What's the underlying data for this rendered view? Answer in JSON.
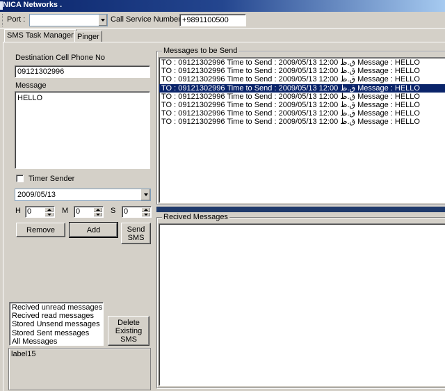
{
  "window": {
    "title": "NICA Networks ."
  },
  "toolbar": {
    "port_label": "Port :",
    "port_value": "",
    "call_service_label": "Call Service Number :",
    "call_service_value": "+9891100500"
  },
  "tabs": [
    {
      "label": "SMS Task Manager",
      "selected": true
    },
    {
      "label": "Pinger",
      "selected": false
    }
  ],
  "form": {
    "destination_label": "Destination Cell Phone No",
    "destination_value": "09121302996",
    "message_label": "Message",
    "message_value": "HELLO",
    "timer_label": "Timer Sender",
    "timer_checked": false,
    "date_value": "2009/05/13",
    "h_label": "H",
    "h_value": "0",
    "m_label": "M",
    "m_value": "0",
    "s_label": "S",
    "s_value": "0",
    "remove_button": "Remove",
    "add_button": "Add",
    "send_button": "Send SMS"
  },
  "messages_to_send": {
    "title": "Messages to be Send",
    "selected_index": 3,
    "items": [
      "TO : 09121302996 Time to Send : 2009/05/13 12:00 ق.ظ Message : HELLO",
      "TO : 09121302996 Time to Send : 2009/05/13 12:00 ق.ظ Message : HELLO",
      "TO : 09121302996 Time to Send : 2009/05/13 12:00 ق.ظ Message : HELLO",
      "TO : 09121302996 Time to Send : 2009/05/13 12:00 ق.ظ Message : HELLO",
      "TO : 09121302996 Time to Send : 2009/05/13 12:00 ق.ظ Message : HELLO",
      "TO : 09121302996 Time to Send : 2009/05/13 12:00 ق.ظ Message : HELLO",
      "TO : 09121302996 Time to Send : 2009/05/13 12:00 ق.ظ Message : HELLO",
      "TO : 09121302996 Time to Send : 2009/05/13 12:00 ق.ظ Message : HELLO"
    ]
  },
  "received": {
    "title": "Recived Messages"
  },
  "filter_list": {
    "items": [
      "Recived unread messages",
      "Recived read messages",
      "Stored Unsend messages",
      "Stored Sent messages",
      "All Messages"
    ]
  },
  "delete_button": "Delete Existing SMS",
  "status_label": "label15",
  "colors": {
    "selection": "#0a246a",
    "face": "#d4d0c8",
    "splitter": "#1f3a6b"
  }
}
